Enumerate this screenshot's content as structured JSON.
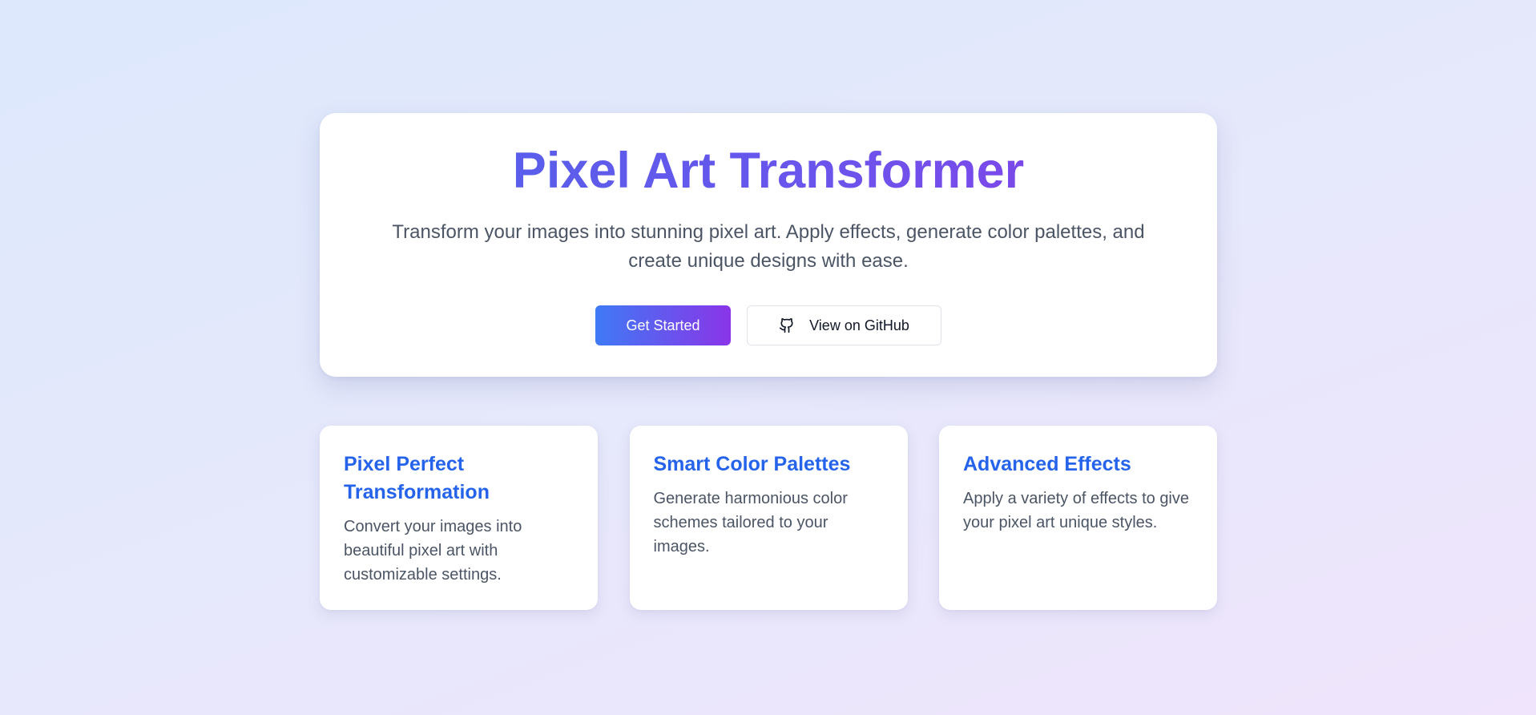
{
  "hero": {
    "title": "Pixel Art Transformer",
    "description": "Transform your images into stunning pixel art. Apply effects, generate color palettes, and create unique designs with ease.",
    "primary_button_label": "Get Started",
    "secondary_button_label": "View on GitHub",
    "secondary_button_icon": "github-icon"
  },
  "features": [
    {
      "title": "Pixel Perfect Transformation",
      "text": "Convert your images into beautiful pixel art with customizable settings."
    },
    {
      "title": "Smart Color Palettes",
      "text": "Generate harmonious color schemes tailored to your images."
    },
    {
      "title": "Advanced Effects",
      "text": "Apply a variety of effects to give your pixel art unique styles."
    }
  ],
  "colors": {
    "title_gradient_start": "#4f63ea",
    "title_gradient_end": "#8a3ee6",
    "button_gradient_start": "#3f7af5",
    "button_gradient_end": "#8a35e8",
    "feature_title": "#2563eb",
    "body_text": "#4b5565"
  }
}
